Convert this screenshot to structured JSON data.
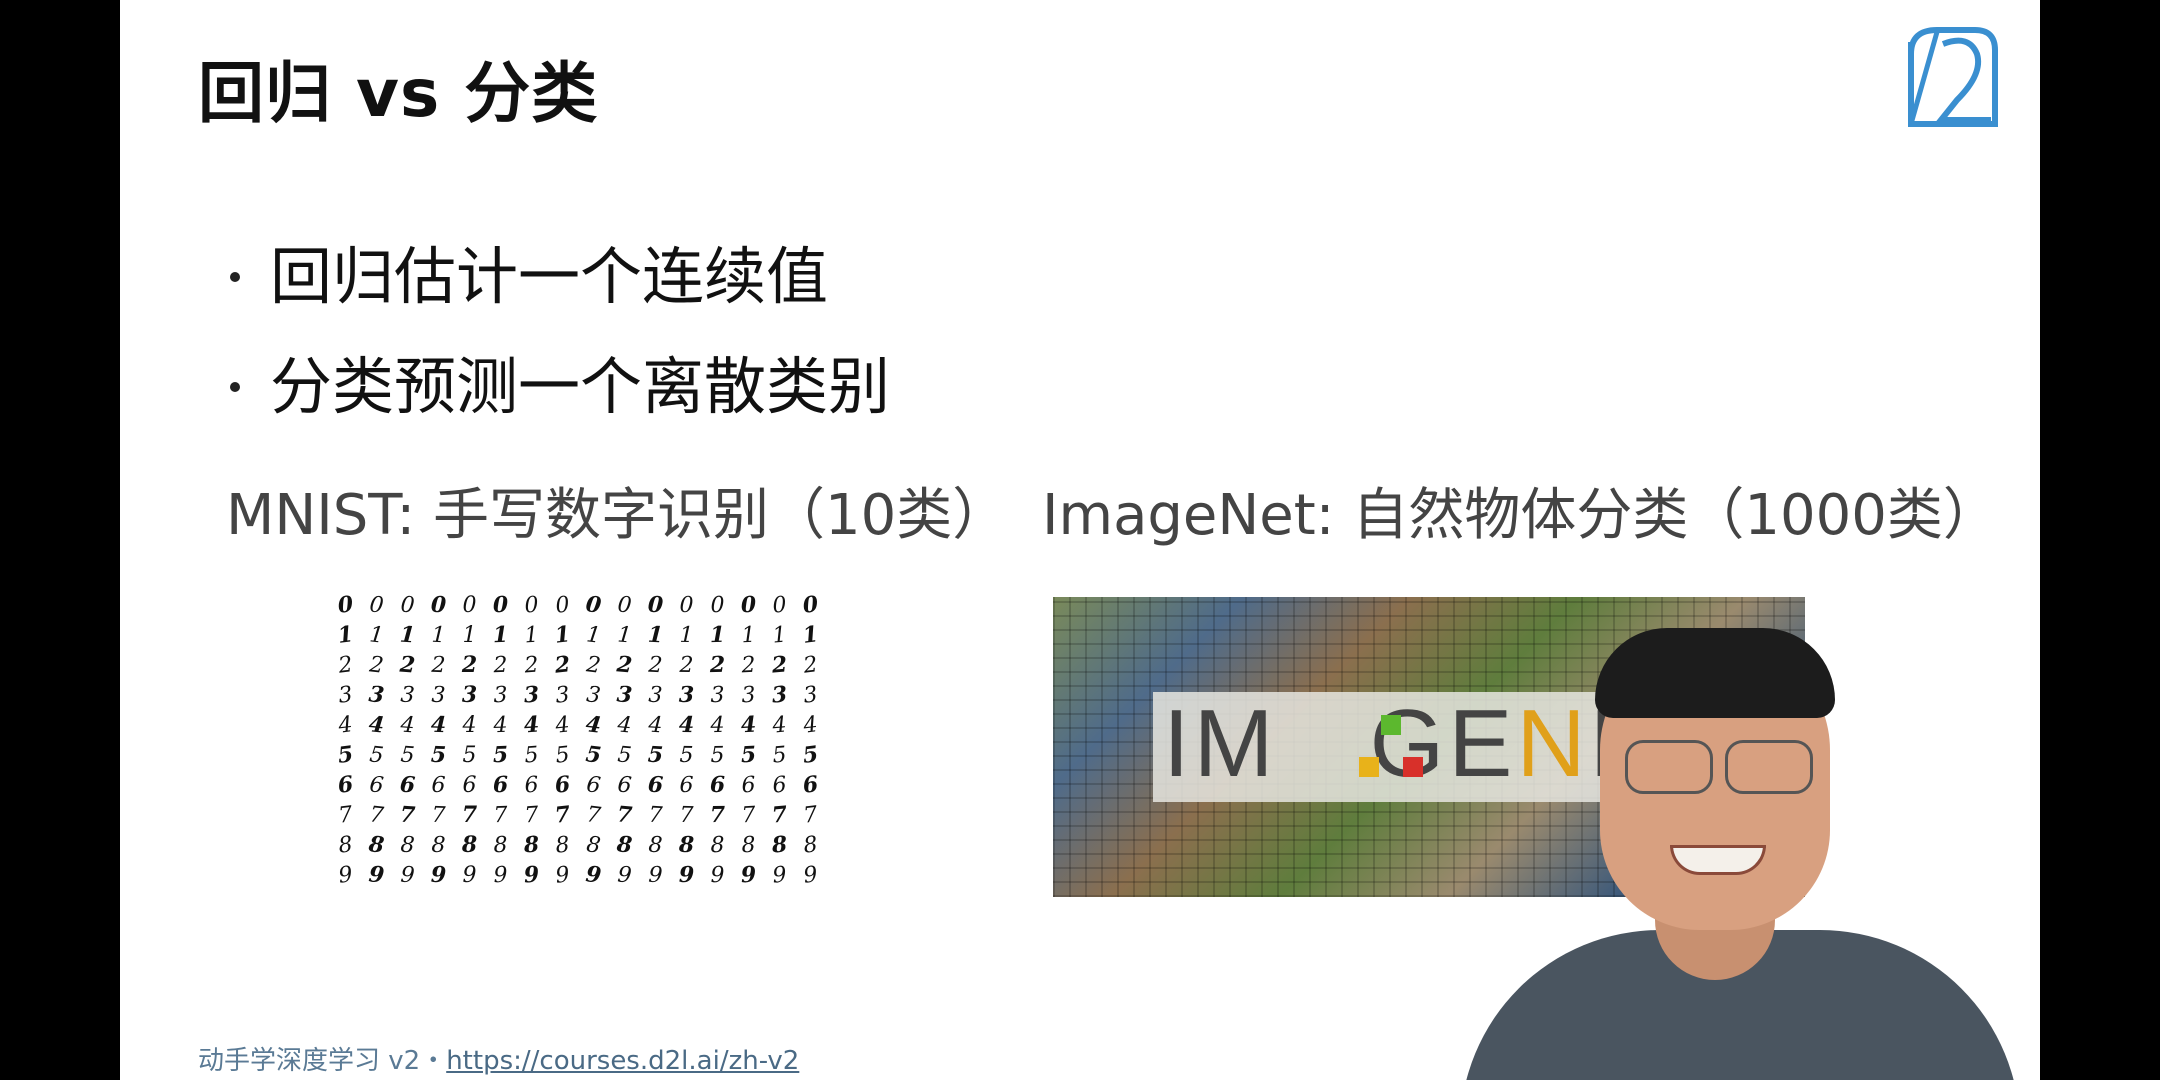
{
  "slide": {
    "title": "回归 vs 分类",
    "bullets": [
      "回归估计一个连续值",
      "分类预测一个离散类别"
    ],
    "captions": {
      "mnist": "MNIST: 手写数字识别（10类）",
      "imagenet": "ImageNet: 自然物体分类（1000类）"
    },
    "mnist_digits": [
      "0",
      "1",
      "2",
      "3",
      "4",
      "5",
      "6",
      "7",
      "8",
      "9"
    ],
    "imagenet_logo_text": "IM GENE",
    "footer": {
      "course": "动手学深度学习 v2・",
      "url": "https://courses.d2l.ai/zh-v2"
    }
  },
  "colors": {
    "logo_blue": "#3a8fd0",
    "footer_text": "#5a7a95",
    "imagenet_green": "#5cb82e",
    "imagenet_red": "#d8302a",
    "imagenet_yellow": "#e8b21a"
  },
  "icons": {
    "logo": "d2l-logo-icon"
  }
}
